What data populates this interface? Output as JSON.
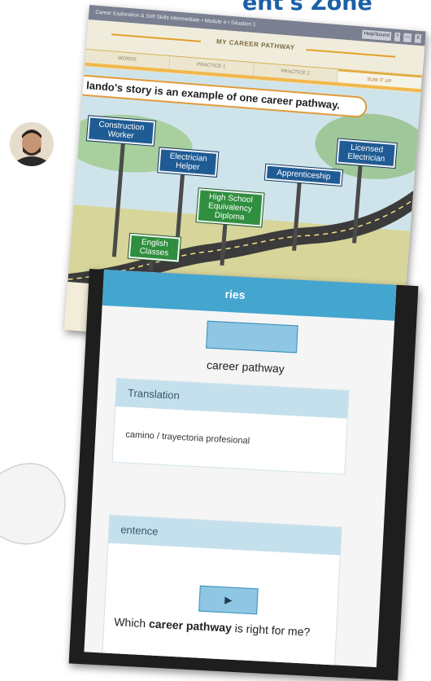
{
  "banner": {
    "title": "ent's Zone"
  },
  "app": {
    "window_title": "Career Exploration & Soft Skills Intermediate • Module 4 • Situation 1",
    "window_buttons": [
      "Help/Sound",
      "?",
      "—",
      "X"
    ],
    "header_title": "MY CAREER PATHWAY",
    "tabs": [
      {
        "label": "WORDS",
        "active": false
      },
      {
        "label": "PRACTICE 1",
        "active": false
      },
      {
        "label": "PRACTICE 2",
        "active": false
      },
      {
        "label": "SUM IT UP",
        "active": true
      }
    ],
    "story_text": "lando's story is an example of one career pathway.",
    "signs": [
      {
        "label": "Construction Worker",
        "color": "blue"
      },
      {
        "label": "Electrician Helper",
        "color": "blue"
      },
      {
        "label": "Apprenticeship",
        "color": "blue"
      },
      {
        "label": "Licensed Electrician",
        "color": "blue"
      },
      {
        "label": "High School Equivalency Diploma",
        "color": "green"
      },
      {
        "label": "English Classes",
        "color": "green"
      }
    ],
    "thumbnail_count": 4
  },
  "phone": {
    "header_text": "ries",
    "term": "career pathway",
    "translation_heading": "Translation",
    "translation_value": "camino / trayectoria profesional",
    "sentence_heading": "entence",
    "play_icon": "▶",
    "example_parts": {
      "before": "Which ",
      "bold": "career pathway",
      "after": " is right for me?"
    }
  },
  "colors": {
    "accent_blue": "#44a5cf",
    "sign_blue": "#1f5b94",
    "sign_green": "#2f8f3f",
    "orange": "#e39b3a"
  }
}
